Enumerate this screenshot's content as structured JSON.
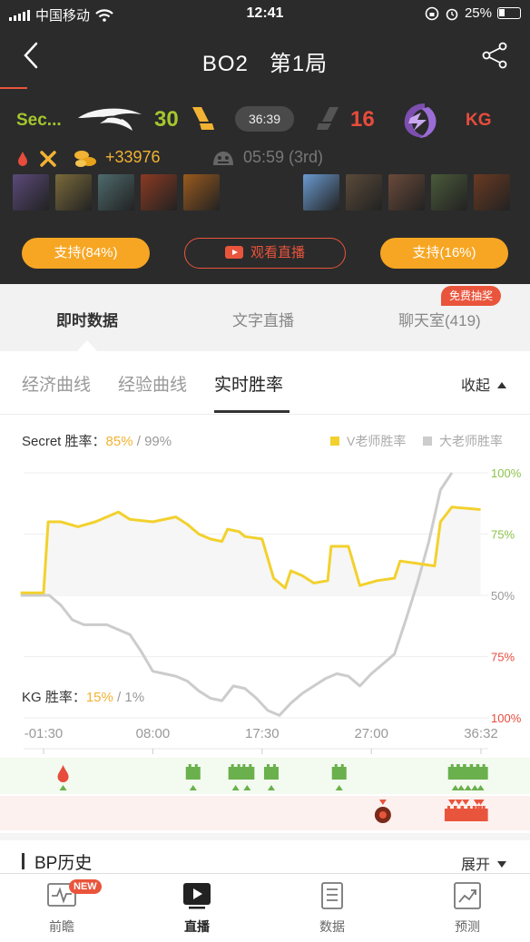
{
  "status_bar": {
    "carrier": "中国移动",
    "time": "12:41",
    "battery": "25%"
  },
  "nav": {
    "title": "BO2   第1局"
  },
  "match": {
    "team_a": {
      "name": "Sec...",
      "kills": "30",
      "color": "#a4c62e"
    },
    "team_b": {
      "name": "KG",
      "kills": "16",
      "color": "#e74c3c"
    },
    "clock": "36:39",
    "gold_lead": "+33976",
    "roshan": "05:59 (3rd)"
  },
  "heroes": {
    "team_a": [
      "#5b4a7a",
      "#7a6a3b",
      "#4e6a6d",
      "#8a3a22",
      "#9a5a1e"
    ],
    "team_b": [
      "#6a9ad0",
      "#5a4a3a",
      "#6a4a3a",
      "#4a5a3a",
      "#6a3a22"
    ]
  },
  "actions": {
    "support_a": "支持(84%)",
    "watch_live": "观看直播",
    "support_b": "支持(16%)"
  },
  "tabs": {
    "live_data": "即时数据",
    "text_live": "文字直播",
    "chat": "聊天室(419)",
    "lottery_badge": "免费抽奖"
  },
  "subtabs": {
    "economy": "经济曲线",
    "experience": "经验曲线",
    "win_rate": "实时胜率",
    "collapse": "收起"
  },
  "win_rate": {
    "team_a_label": "Secret 胜率：",
    "team_a_v": "85%",
    "team_a_big": "99%",
    "team_b_label": "KG 胜率：",
    "team_b_v": "15%",
    "team_b_big": "1%",
    "sep": " / ",
    "legend_v": "V老师胜率",
    "legend_big": "大老师胜率"
  },
  "chart_data": {
    "type": "line",
    "x_ticks": [
      "-01:30",
      "08:00",
      "17:30",
      "27:00",
      "36:32"
    ],
    "x_tick_minutes": [
      -1.5,
      8,
      17.5,
      27,
      36.53
    ],
    "y_ticks": [
      "100%",
      "75%",
      "50%",
      "75%",
      "100%"
    ],
    "y_tick_colors": [
      "#8bc34a",
      "#8bc34a",
      "#999999",
      "#e74c3c",
      "#e74c3c"
    ],
    "ylim": [
      0,
      100
    ],
    "series": [
      {
        "name": "V老师胜率",
        "color": "#f2d12e",
        "points": [
          [
            -3.5,
            51
          ],
          [
            -1.5,
            51
          ],
          [
            -1.1,
            80
          ],
          [
            0,
            80
          ],
          [
            1.5,
            78
          ],
          [
            3,
            80
          ],
          [
            5,
            84
          ],
          [
            6,
            81
          ],
          [
            8,
            80
          ],
          [
            10,
            82
          ],
          [
            11,
            79
          ],
          [
            12,
            75
          ],
          [
            13,
            73
          ],
          [
            14,
            72
          ],
          [
            14.5,
            77
          ],
          [
            15.5,
            76
          ],
          [
            16,
            74
          ],
          [
            17.5,
            73
          ],
          [
            18.5,
            57
          ],
          [
            19.5,
            53
          ],
          [
            20,
            60
          ],
          [
            21,
            58
          ],
          [
            22,
            55
          ],
          [
            23.2,
            56
          ],
          [
            23.5,
            70
          ],
          [
            25,
            70
          ],
          [
            26,
            54
          ],
          [
            27.5,
            56
          ],
          [
            29,
            57
          ],
          [
            29.5,
            64
          ],
          [
            31,
            63
          ],
          [
            32.5,
            62
          ],
          [
            33,
            80
          ],
          [
            34,
            86
          ],
          [
            36.5,
            85
          ]
        ]
      },
      {
        "name": "大老师胜率",
        "color": "#cccccc",
        "points": [
          [
            -3.5,
            50
          ],
          [
            -1,
            50
          ],
          [
            0,
            46
          ],
          [
            1,
            40
          ],
          [
            2,
            38
          ],
          [
            3,
            38
          ],
          [
            4,
            38
          ],
          [
            5,
            36
          ],
          [
            6,
            34
          ],
          [
            7,
            27
          ],
          [
            8,
            19
          ],
          [
            9,
            18
          ],
          [
            10,
            17
          ],
          [
            11,
            15
          ],
          [
            12,
            11
          ],
          [
            13,
            8
          ],
          [
            14,
            7
          ],
          [
            15,
            13
          ],
          [
            16,
            12
          ],
          [
            17,
            8
          ],
          [
            18,
            3
          ],
          [
            19,
            1
          ],
          [
            20,
            6
          ],
          [
            21,
            10
          ],
          [
            22,
            13
          ],
          [
            23,
            16
          ],
          [
            24,
            18
          ],
          [
            25,
            17
          ],
          [
            26,
            13
          ],
          [
            27,
            18
          ],
          [
            28,
            22
          ],
          [
            29,
            26
          ],
          [
            30,
            40
          ],
          [
            31,
            55
          ],
          [
            32,
            72
          ],
          [
            33,
            93
          ],
          [
            34,
            100
          ]
        ]
      }
    ],
    "events": {
      "first_blood_minute": 0.2,
      "team_a_towers": [
        11.5,
        15.2,
        16.2,
        18.3,
        24.2,
        34.3,
        34.8,
        35.4,
        36.0,
        36.5
      ],
      "team_b_towers": [
        34.0,
        34.6,
        35.2,
        36.2,
        36.5
      ],
      "team_b_events": [
        28.0
      ]
    }
  },
  "bp": {
    "title": "BP历史",
    "expand": "展开"
  },
  "tabbar": {
    "preview": "前瞻",
    "live": "直播",
    "data": "数据",
    "predict": "预测",
    "new_badge": "NEW"
  }
}
